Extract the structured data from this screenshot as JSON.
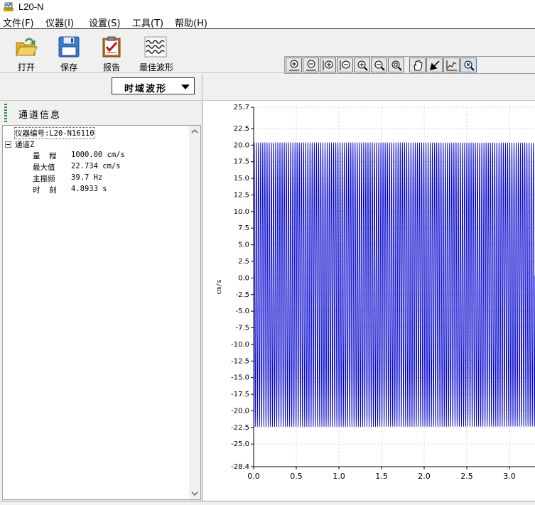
{
  "window": {
    "title": "L20-N"
  },
  "menu": [
    {
      "label": "文件(F)"
    },
    {
      "label": "仪器(I)"
    },
    {
      "label": "设置(S)"
    },
    {
      "label": "工具(T)"
    },
    {
      "label": "帮助(H)"
    }
  ],
  "toolbar": {
    "open_label": "打开",
    "save_label": "保存",
    "report_label": "报告",
    "best_wave_label": "最佳波形"
  },
  "zoom_tools": [
    "zoom-in-x-icon",
    "zoom-out-x-icon",
    "zoom-in-y-icon",
    "zoom-out-y-icon",
    "zoom-in-icon",
    "zoom-out-icon",
    "zoom-fit-icon",
    "pan-hand-icon",
    "undo-arrow-icon",
    "curve-icon",
    "zoom-reset-icon"
  ],
  "wave_selector": {
    "value": "时域波形"
  },
  "panel": {
    "title": "通道信息"
  },
  "tree": {
    "instrument": "仪器编号:L20-N16110",
    "channel": "通道Z",
    "rows": [
      {
        "key": "量  程",
        "value": "1000.00 cm/s"
      },
      {
        "key": "最大值",
        "value": "22.734 cm/s"
      },
      {
        "key": "主振频",
        "value": "39.7 Hz"
      },
      {
        "key": "时  刻",
        "value": "4.8933 s"
      }
    ]
  },
  "chart_data": {
    "type": "line",
    "ylabel": "cm/s",
    "xlabel": "",
    "title": "",
    "ylim": [
      -28.4,
      25.7
    ],
    "xlim": [
      0.0,
      3.3
    ],
    "yticks": [
      25.7,
      22.5,
      20.0,
      17.5,
      15.0,
      12.5,
      10.0,
      7.5,
      5.0,
      2.5,
      0.0,
      -2.5,
      -5.0,
      -7.5,
      -10.0,
      -12.5,
      -15.0,
      -17.5,
      -20.0,
      -22.5,
      -25.0,
      -28.4
    ],
    "ytick_labels": [
      "25.7",
      "22.5",
      "20.0",
      "17.5",
      "15.0",
      "12.5",
      "10.0",
      "7.5",
      "5.0",
      "2.5",
      "0.0",
      "-2.5",
      "-5.0",
      "-7.5",
      "-10.0",
      "-12.5",
      "-15.0",
      "-17.5",
      "-20.0",
      "-22.5",
      "-25.0",
      "-28.4"
    ],
    "xticks": [
      0.0,
      0.5,
      1.0,
      1.5,
      2.0,
      2.5,
      3.0
    ],
    "xtick_labels": [
      "0.0",
      "0.5",
      "1.0",
      "1.5",
      "2.0",
      "2.5",
      "3.0"
    ],
    "grid": true,
    "series": [
      {
        "color": "#0000cc",
        "frequency_hz": 39.7,
        "max": 20.4,
        "min": -22.4,
        "x_start": 0.0,
        "x_end": 3.3
      }
    ]
  },
  "colors": {
    "wave": "#0000cc",
    "grip": "#2e8b2e"
  }
}
